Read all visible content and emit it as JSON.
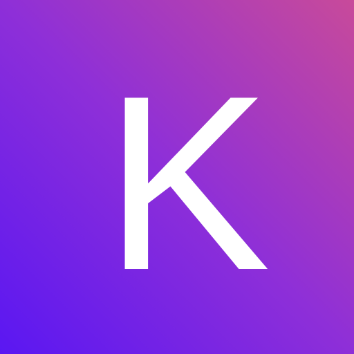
{
  "logo": {
    "letter": "K",
    "letter_color": "#FFFFFF",
    "gradient": {
      "top_right": "#C84A9A",
      "middle": "#8E2FD8",
      "bottom_left": "#5A17F2"
    }
  }
}
